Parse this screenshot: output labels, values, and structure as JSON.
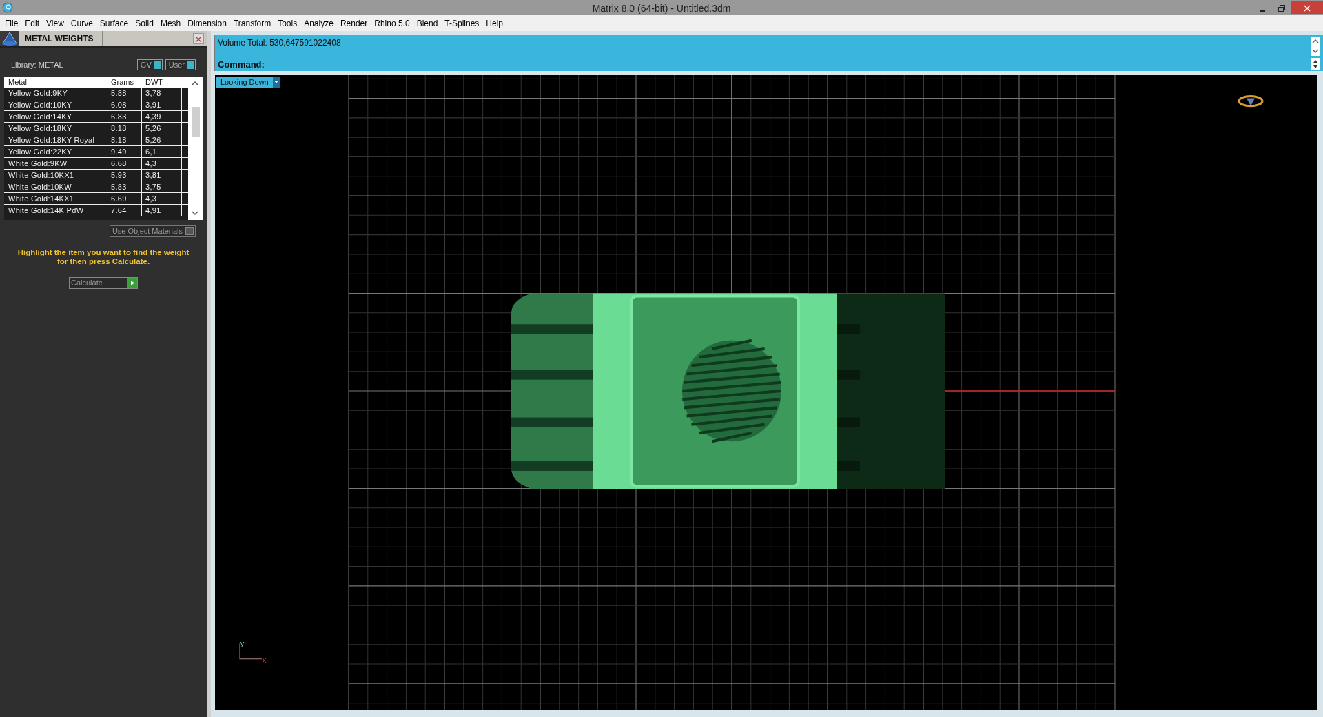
{
  "window": {
    "title": "Matrix 8.0 (64-bit) - Untitled.3dm"
  },
  "menu": [
    "File",
    "Edit",
    "View",
    "Curve",
    "Surface",
    "Solid",
    "Mesh",
    "Dimension",
    "Transform",
    "Tools",
    "Analyze",
    "Render",
    "Rhino 5.0",
    "Blend",
    "T-Splines",
    "Help"
  ],
  "panel": {
    "title": "METAL WEIGHTS",
    "library": "Library: METAL",
    "toggles": [
      {
        "label": "GV",
        "on": true
      },
      {
        "label": "User",
        "on": true
      }
    ],
    "table": {
      "columns": [
        "Metal",
        "Grams",
        "DWT"
      ],
      "rows": [
        {
          "cells": [
            "Yellow Gold:9KY",
            "5.88",
            "3,78"
          ],
          "selected": false
        },
        {
          "cells": [
            "Yellow Gold:10KY",
            "6.08",
            "3,91"
          ],
          "selected": false
        },
        {
          "cells": [
            "Yellow Gold:14KY",
            "6.83",
            "4,39"
          ],
          "selected": false
        },
        {
          "cells": [
            "Yellow Gold:18KY",
            "8.18",
            "5,26"
          ],
          "selected": false
        },
        {
          "cells": [
            "Yellow Gold:18KY Royal",
            "8.18",
            "5,26"
          ],
          "selected": false
        },
        {
          "cells": [
            "Yellow Gold:22KY",
            "9.49",
            "6,1"
          ],
          "selected": false
        },
        {
          "cells": [
            "White Gold:9KW",
            "6.68",
            "4,3"
          ],
          "selected": false
        },
        {
          "cells": [
            "White Gold:10KX1",
            "5.93",
            "3,81"
          ],
          "selected": false
        },
        {
          "cells": [
            "White Gold:10KW",
            "5.83",
            "3,75"
          ],
          "selected": false
        },
        {
          "cells": [
            "White Gold:14KX1",
            "6.69",
            "4,3"
          ],
          "selected": false
        },
        {
          "cells": [
            "White Gold:14K PdW",
            "7.64",
            "4,91"
          ],
          "selected": false
        }
      ]
    },
    "use_object_materials": {
      "label": "Use Object Materials",
      "checked": false
    },
    "instruction": "Highlight the item you want to find the weight for then press Calculate.",
    "calculate_button": "Calculate"
  },
  "command_area": {
    "history": "Volume Total: 530,647591022408",
    "prompt": "Command:"
  },
  "viewport": {
    "view_menu": "Looking Down",
    "axis_y": "y",
    "axis_x": "x"
  }
}
